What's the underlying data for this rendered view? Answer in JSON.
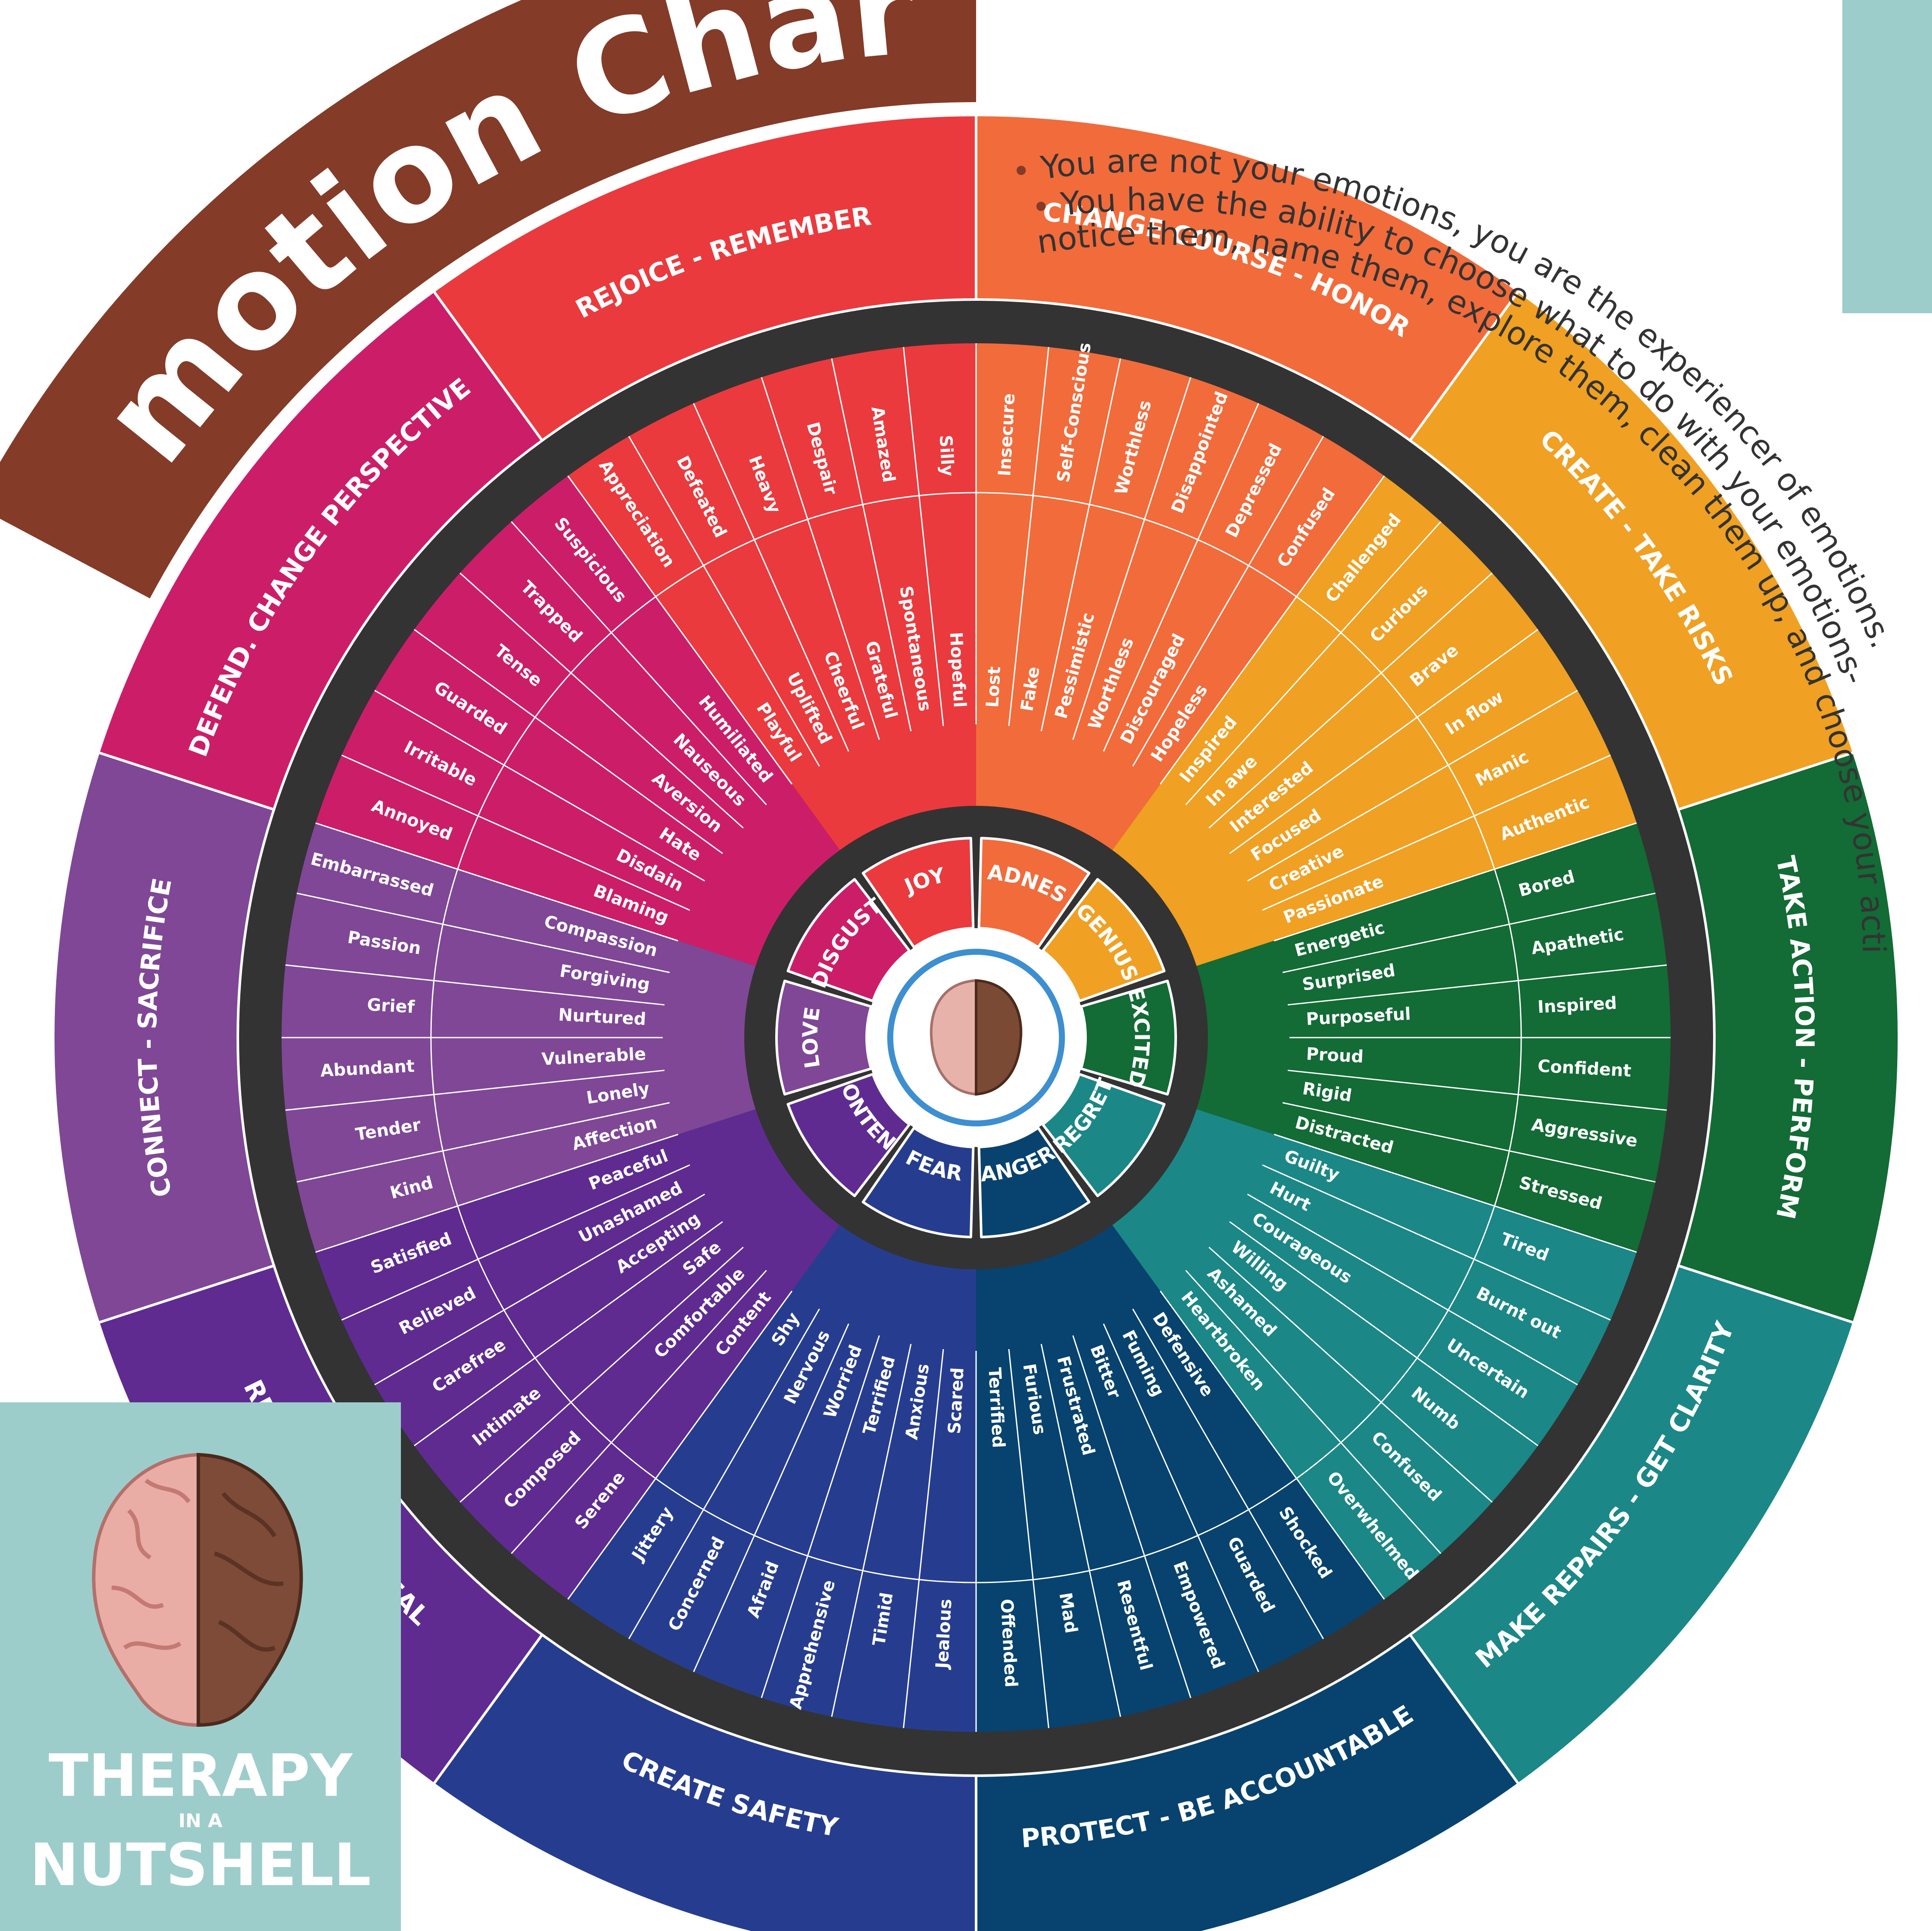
{
  "title": "Emotion Chart",
  "tagline": {
    "bullet1": "You are not your emotions, you are the experiencer of emotions.",
    "bullet2_line1": "You have the ability to choose what to do with your emotions-",
    "bullet2_line2": "notice them, name them, explore them, clean them up, and choose your actions."
  },
  "logo": {
    "line1": "THERAPY",
    "line2": "IN A",
    "line3": "NUTSHELL",
    "icon": "brain-walnut-icon"
  },
  "colors": {
    "title_band": "#843b28",
    "ring_dark": "#333333",
    "logo_bg": "#9dcdcb",
    "joy": "#ea3a3e",
    "sadness": "#f26b3b",
    "genius": "#f0a022",
    "excited": "#136b35",
    "regret": "#1b8787",
    "anger": "#07436e",
    "fear": "#263d8f",
    "content": "#5f2b91",
    "love": "#7f4796",
    "disgust": "#cc1e68"
  },
  "center": {
    "icon": "brain-icon"
  },
  "sectors": [
    {
      "name": "JOY",
      "action": "REJOICE - REMEMBER",
      "color": "#ea3a3e",
      "inner": [
        "Playful",
        "Uplifted",
        "Cheerful",
        "Grateful",
        "Spontaneous",
        "Hopeful"
      ],
      "outer": [
        "Appreciation",
        "Defeated",
        "Heavy",
        "Despair",
        "Amazed",
        "Silly"
      ]
    },
    {
      "name": "SADNESS",
      "action": "CHANGE COURSE - HONOR",
      "color": "#f26b3b",
      "inner": [
        "Lost",
        "Fake",
        "Pessimistic",
        "Worthless",
        "Discouraged",
        "Hopeless"
      ],
      "outer": [
        "Insecure",
        "Self-Conscious",
        "Worthless",
        "Disappointed",
        "Depressed",
        "Confused"
      ]
    },
    {
      "name": "GENIUS",
      "action": "CREATE - TAKE RISKS",
      "color": "#f0a022",
      "inner": [
        "Inspired",
        "In awe",
        "Interested",
        "Focused",
        "Creative",
        "Passionate"
      ],
      "outer": [
        "Challenged",
        "Curious",
        "Brave",
        "In flow",
        "Manic",
        "Authentic"
      ]
    },
    {
      "name": "EXCITED",
      "action": "TAKE ACTION - PERFORM",
      "color": "#136b35",
      "inner": [
        "Energetic",
        "Surprised",
        "Purposeful",
        "Proud",
        "Rigid",
        "Distracted"
      ],
      "outer": [
        "Bored",
        "Apathetic",
        "Inspired",
        "Confident",
        "Aggressive",
        "Stressed"
      ]
    },
    {
      "name": "REGRET",
      "action": "MAKE REPAIRS - GET CLARITY",
      "color": "#1b8787",
      "inner": [
        "Guilty",
        "Hurt",
        "Courageous",
        "Willing",
        "Ashamed",
        "Heartbroken"
      ],
      "outer": [
        "Tired",
        "Burnt out",
        "Uncertain",
        "Numb",
        "Confused",
        "Overwhelmed"
      ]
    },
    {
      "name": "ANGER",
      "action": "PROTECT - BE ACCOUNTABLE",
      "color": "#07436e",
      "inner": [
        "Defensive",
        "Fuming",
        "Bitter",
        "Frustrated",
        "Furious",
        "Terrified"
      ],
      "outer": [
        "Shocked",
        "Guarded",
        "Empowered",
        "Resentful",
        "Mad",
        "Offended"
      ]
    },
    {
      "name": "FEAR",
      "action": "CREATE SAFETY",
      "color": "#263d8f",
      "inner": [
        "Scared",
        "Anxious",
        "Terrified",
        "Worried",
        "Nervous",
        "Shy"
      ],
      "outer": [
        "Jealous",
        "Timid",
        "Apprehensive",
        "Afraid",
        "Concerned",
        "Jittery"
      ]
    },
    {
      "name": "CONTENT",
      "action": "RELAX - REST - HEAL",
      "color": "#5f2b91",
      "inner": [
        "Content",
        "Comfortable",
        "Safe",
        "Accepting",
        "Unashamed",
        "Peaceful"
      ],
      "outer": [
        "Serene",
        "Composed",
        "Intimate",
        "Carefree",
        "Relieved",
        "Satisfied"
      ]
    },
    {
      "name": "LOVE",
      "action": "CONNECT - SACRIFICE",
      "color": "#7f4796",
      "inner": [
        "Affection",
        "Lonely",
        "Vulnerable",
        "Nurtured",
        "Forgiving",
        "Compassion"
      ],
      "outer": [
        "Kind",
        "Tender",
        "Abundant",
        "Grief",
        "Passion",
        "Embarrassed"
      ]
    },
    {
      "name": "DISGUST",
      "action": "DEFEND. CHANGE PERSPECTIVE",
      "color": "#cc1e68",
      "inner": [
        "Blaming",
        "Disdain",
        "Hate",
        "Aversion",
        "Nauseous",
        "Humiliated"
      ],
      "outer": [
        "Annoyed",
        "Irritable",
        "Guarded",
        "Tense",
        "Trapped",
        "Suspicious"
      ]
    }
  ]
}
